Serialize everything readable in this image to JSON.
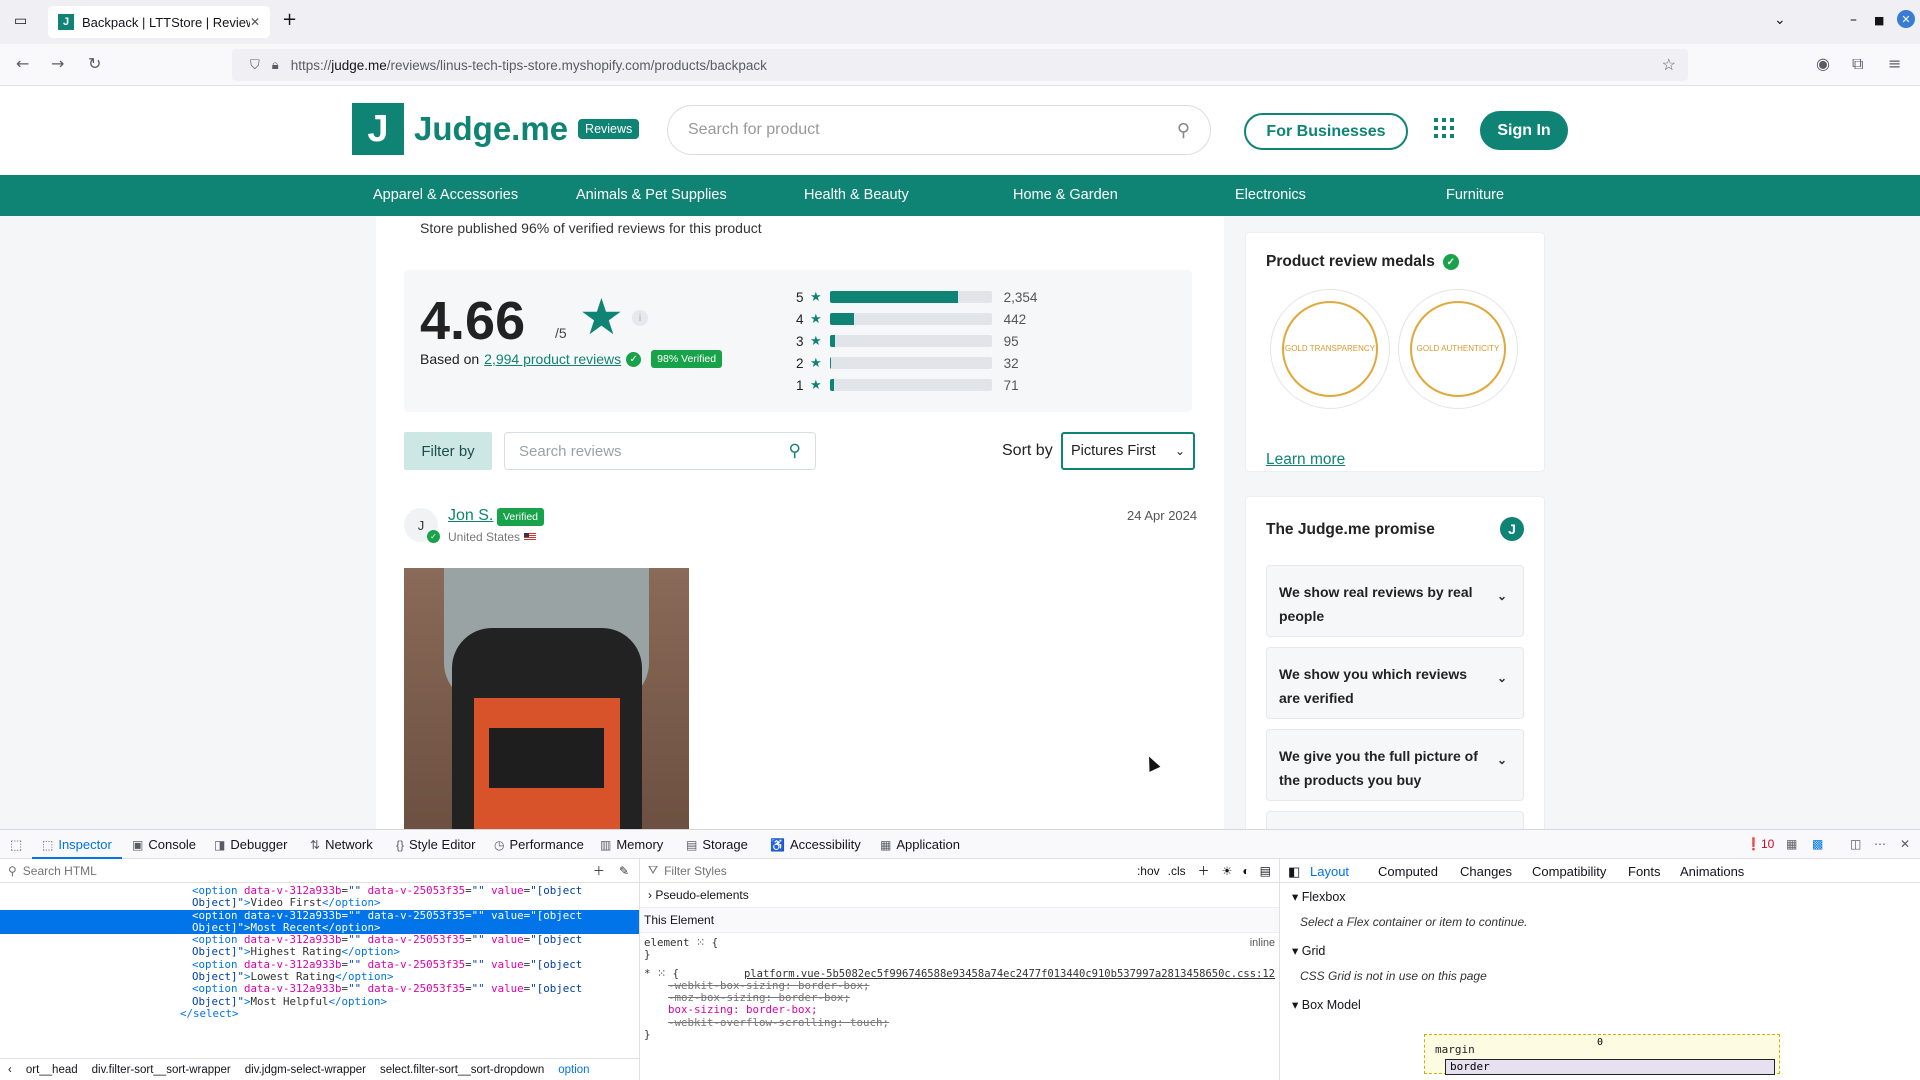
{
  "browser": {
    "tab_title": "Backpack | LTTStore | Review",
    "tab_favicon": "J",
    "url_prefix": "https://",
    "url_host": "judge.me",
    "url_path": "/reviews/linus-tech-tips-store.myshopify.com/products/backpack"
  },
  "header": {
    "logo_letter": "J",
    "logo_word": "Judge.me",
    "logo_badge": "Reviews",
    "search_placeholder": "Search for product",
    "for_businesses": "For Businesses",
    "sign_in": "Sign In"
  },
  "categories": [
    "Apparel & Accessories",
    "Animals & Pet Supplies",
    "Health & Beauty",
    "Home & Garden",
    "Electronics",
    "Furniture"
  ],
  "summary": {
    "published_text": "Store published 96% of verified reviews for this product",
    "average": "4.66",
    "out_of": "/5",
    "based_on_prefix": "Based on",
    "based_on_link": "2,994 product reviews",
    "verified_badge": "98% Verified",
    "histogram": [
      {
        "stars": "5",
        "count": "2,354",
        "fraction": 0.79
      },
      {
        "stars": "4",
        "count": "442",
        "fraction": 0.15
      },
      {
        "stars": "3",
        "count": "95",
        "fraction": 0.03
      },
      {
        "stars": "2",
        "count": "32",
        "fraction": 0.011
      },
      {
        "stars": "1",
        "count": "71",
        "fraction": 0.024
      }
    ]
  },
  "filter": {
    "filter_label": "Filter by",
    "search_placeholder": "Search reviews",
    "sort_label": "Sort by",
    "sort_value": "Pictures First"
  },
  "review": {
    "initial": "J",
    "name": "Jon S.",
    "verified": "Verified",
    "location": "United States",
    "date": "24 Apr 2024"
  },
  "sidebar": {
    "medals_title": "Product review medals",
    "medal_1": "GOLD TRANSPARENCY",
    "medal_2": "GOLD AUTHENTICITY",
    "learn_more": "Learn more",
    "promise_title": "The Judge.me promise",
    "promises": [
      "We show real reviews by real people",
      "We show you which reviews are verified",
      "We give you the full picture of the products you buy"
    ]
  },
  "devtools": {
    "tabs": [
      "Inspector",
      "Console",
      "Debugger",
      "Network",
      "Style Editor",
      "Performance",
      "Memory",
      "Storage",
      "Accessibility",
      "Application"
    ],
    "error_count": "10",
    "search_html_placeholder": "Search HTML",
    "filter_styles_placeholder": "Filter Styles",
    "hov": ":hov",
    "cls": ".cls",
    "pseudo_elements": "Pseudo-elements",
    "this_element": "This Element",
    "element_rule": "element",
    "inline": "inline",
    "css_source": "platform.vue-5b5082ec5f996746588e93458a74ec2477f013440c910b537997a2813458650c.css:12",
    "css_lines": [
      "-webkit-box-sizing: border-box;",
      "-moz-box-sizing: border-box;",
      "box-sizing: border-box;",
      "-webkit-overflow-scrolling: touch;"
    ],
    "html_lines": [
      {
        "opt": "Video First"
      },
      {
        "opt": "Most Recent"
      },
      {
        "opt": "Highest Rating"
      },
      {
        "opt": "Lowest Rating"
      },
      {
        "opt": "Most Helpful"
      }
    ],
    "breadcrumbs": [
      "ort__head",
      "div.filter-sort__sort-wrapper",
      "div.jdgm-select-wrapper",
      "select.filter-sort__sort-dropdown",
      "option"
    ],
    "layout_tabs": [
      "Layout",
      "Computed",
      "Changes",
      "Compatibility",
      "Fonts",
      "Animations"
    ],
    "flexbox": "Flexbox",
    "flexbox_note": "Select a Flex container or item to continue.",
    "grid": "Grid",
    "grid_note": "CSS Grid is not in use on this page",
    "box_model": "Box Model",
    "margin_label": "margin",
    "border_label": "border",
    "zero": "0"
  }
}
